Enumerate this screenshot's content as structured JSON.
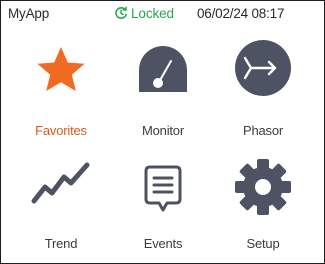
{
  "status_bar": {
    "app_name": "MyApp",
    "lock_label": "Locked",
    "datetime": "06/02/24 08:17"
  },
  "tiles": [
    {
      "label": "Favorites",
      "icon": "star-icon",
      "active": true
    },
    {
      "label": "Monitor",
      "icon": "gauge-icon",
      "active": false
    },
    {
      "label": "Phasor",
      "icon": "phasor-icon",
      "active": false
    },
    {
      "label": "Trend",
      "icon": "trend-icon",
      "active": false
    },
    {
      "label": "Events",
      "icon": "events-icon",
      "active": false
    },
    {
      "label": "Setup",
      "icon": "gear-icon",
      "active": false
    }
  ],
  "colors": {
    "accent": "#f26a21",
    "accent_text": "#e05a1c",
    "icon": "#4e5364",
    "locked": "#22a94a"
  }
}
